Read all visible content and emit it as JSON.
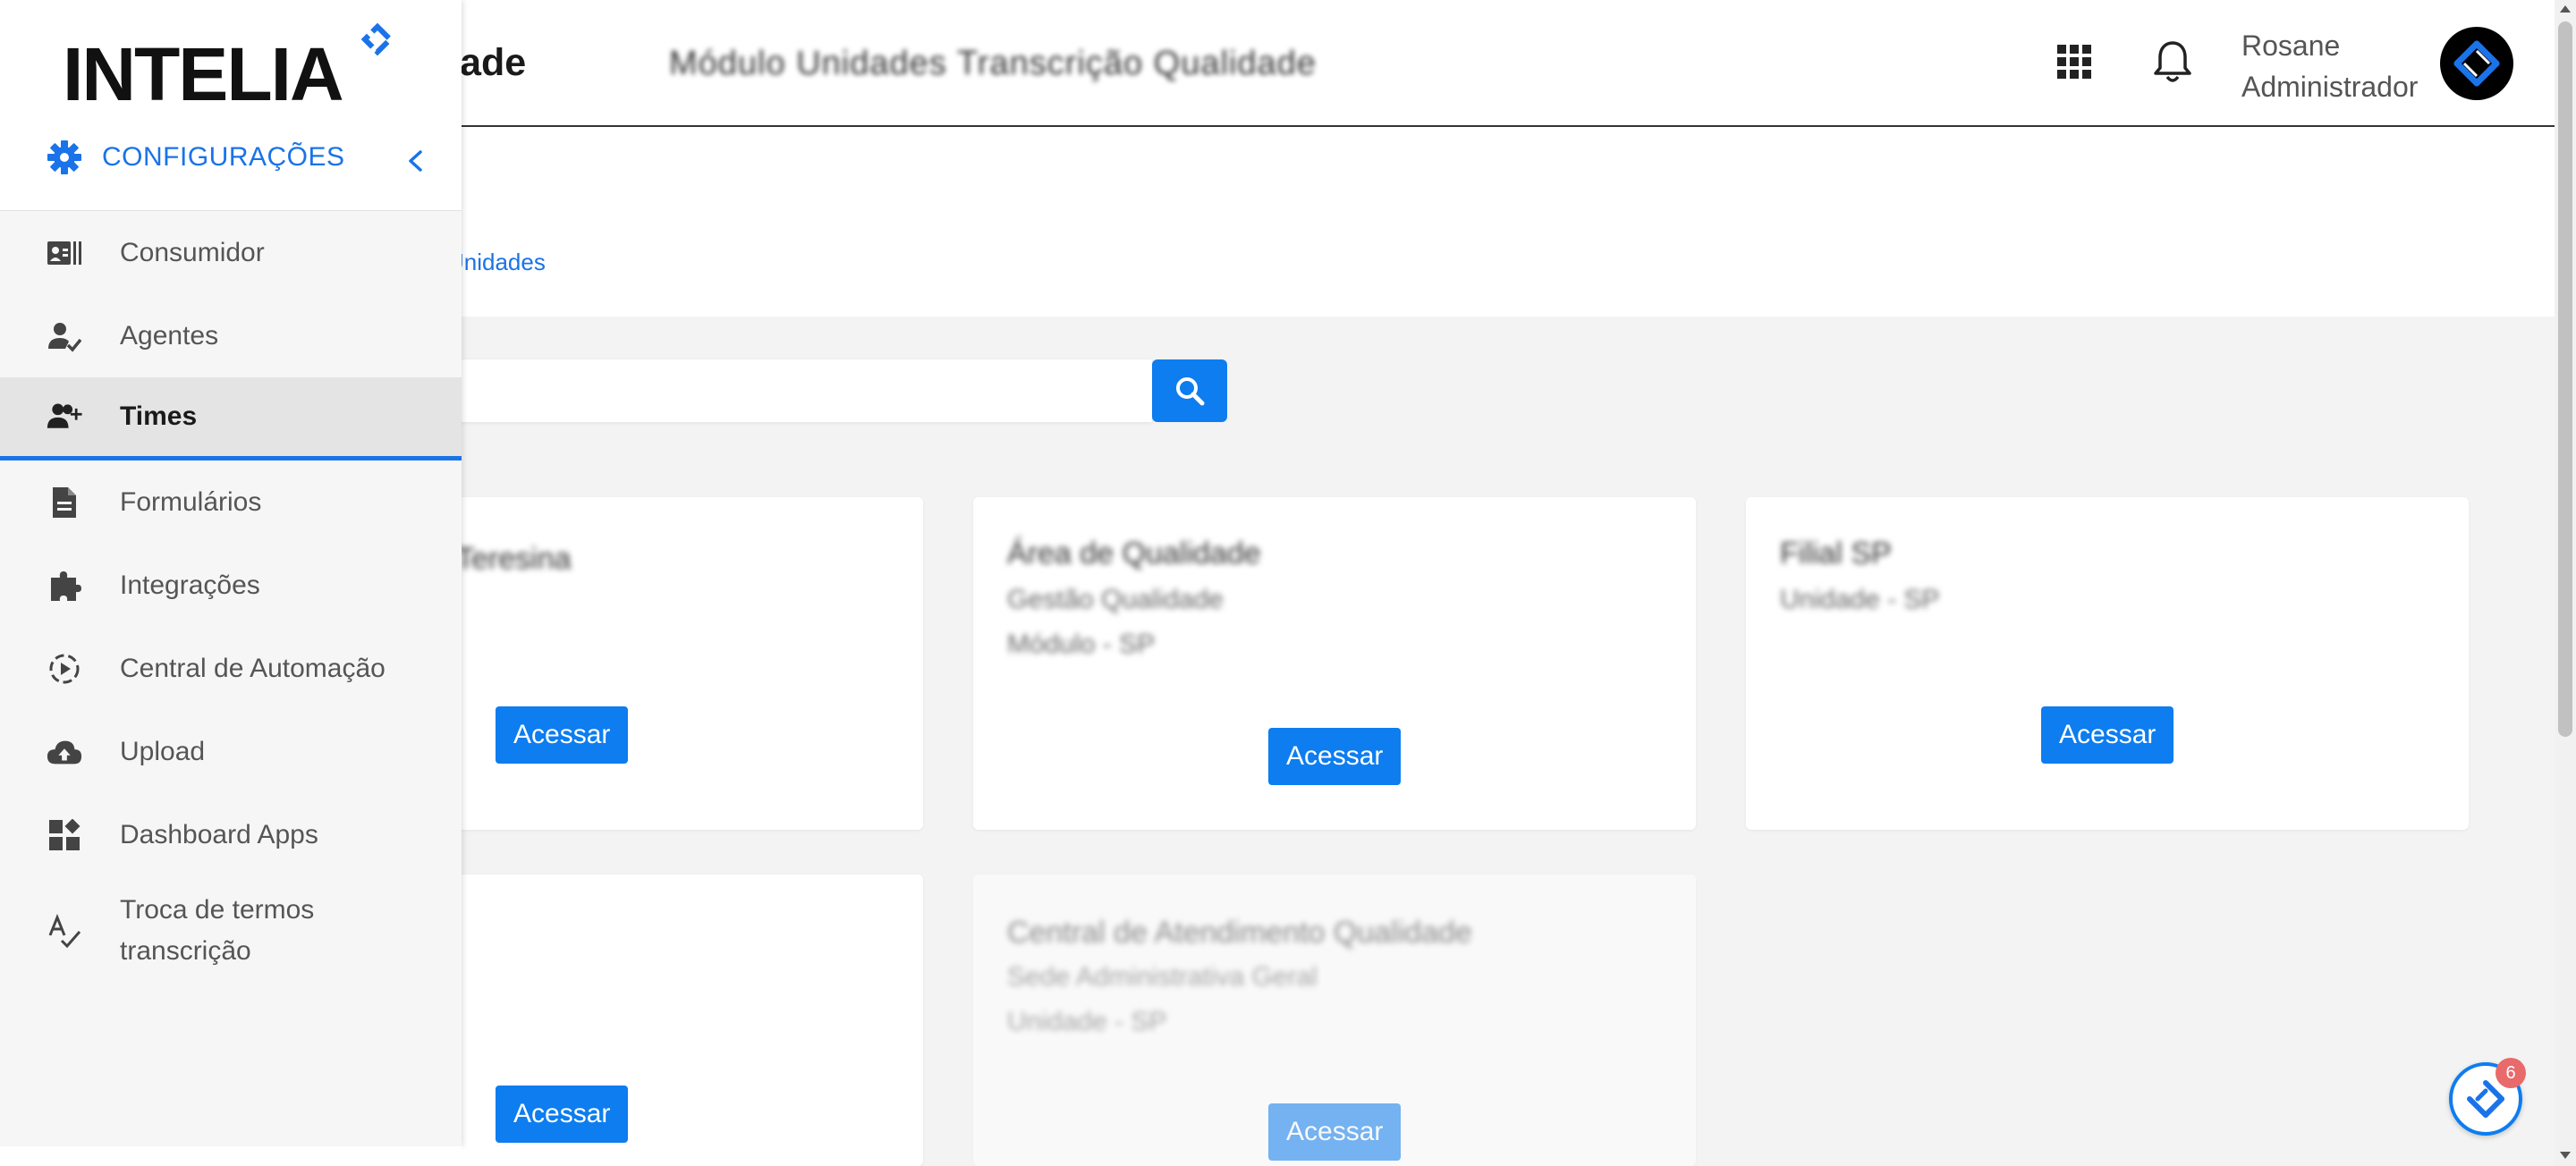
{
  "header": {
    "title": "alidade",
    "blurred_1": "Módulo Unidades",
    "blurred_2": "Transcrição Qualidade",
    "user_name": "Rosane",
    "user_role": "Administrador"
  },
  "breadcrumb": {
    "text": "Unidades"
  },
  "search": {
    "placeholder": "",
    "value": ""
  },
  "cards": [
    {
      "title": "Teresina",
      "sub1": "",
      "sub2": "",
      "button": "Acessar"
    },
    {
      "title": "Área de Qualidade",
      "sub1": "Gestão Qualidade",
      "sub2": "Módulo - SP",
      "button": "Acessar"
    },
    {
      "title": "Filial SP",
      "sub1": "Unidade - SP",
      "sub2": "",
      "button": "Acessar"
    },
    {
      "title": "",
      "sub1": "",
      "sub2": "",
      "button": "Acessar"
    },
    {
      "title": "Central de Atendimento Qualidade",
      "sub1": "Sede Administrativa Geral",
      "sub2": "Unidade - SP",
      "button": "Acessar"
    }
  ],
  "sidebar": {
    "logo": "INTELIA",
    "settings_label": "CONFIGURAÇÕES",
    "items": [
      {
        "label": "Consumidor",
        "icon": "contact-card-icon"
      },
      {
        "label": "Agentes",
        "icon": "user-check-icon"
      },
      {
        "label": "Times",
        "icon": "user-plus-icon",
        "active": true
      },
      {
        "label": "Formulários",
        "icon": "document-icon"
      },
      {
        "label": "Integrações",
        "icon": "puzzle-icon"
      },
      {
        "label": "Central de Automação",
        "icon": "automation-icon"
      },
      {
        "label": "Upload",
        "icon": "cloud-upload-icon"
      },
      {
        "label": "Dashboard Apps",
        "icon": "dashboard-icon"
      },
      {
        "label": "Troca de termos transcrição",
        "icon": "spellcheck-icon"
      }
    ]
  },
  "chat": {
    "badge": "6"
  },
  "colors": {
    "accent": "#0d7df0",
    "link": "#1a73e8",
    "badge": "#e86a6a"
  }
}
